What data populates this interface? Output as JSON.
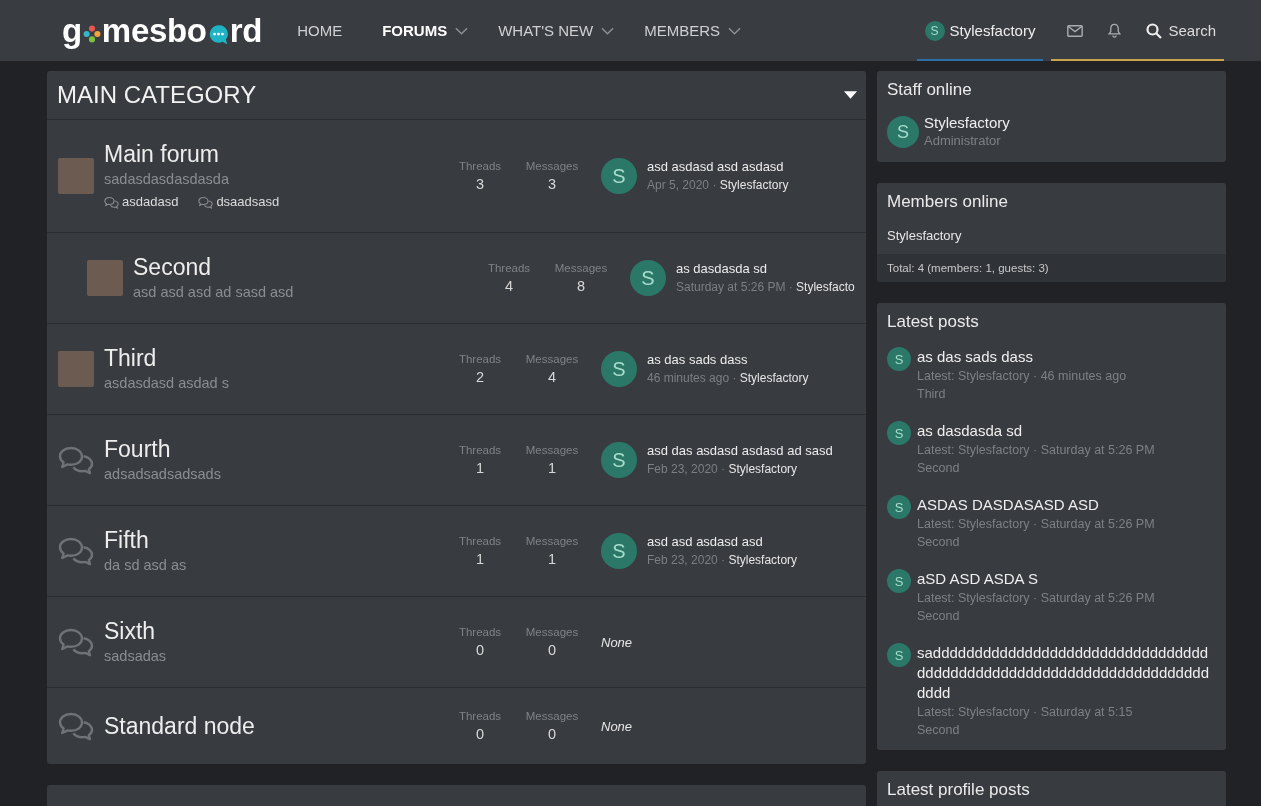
{
  "header": {
    "logo": {
      "parts": [
        "g",
        "mesbo",
        "rd"
      ]
    },
    "nav": [
      {
        "label": "HOME",
        "selected": false,
        "has_menu": false
      },
      {
        "label": "FORUMS",
        "selected": true,
        "has_menu": true
      },
      {
        "label": "WHAT'S NEW",
        "selected": false,
        "has_menu": true
      },
      {
        "label": "MEMBERS",
        "selected": false,
        "has_menu": true
      }
    ],
    "user": {
      "avatar_letter": "S",
      "name": "Stylesfactory"
    },
    "search": {
      "label": "Search"
    }
  },
  "category": {
    "title": "MAIN CATEGORY",
    "expanded": true,
    "forums": [
      {
        "kind": "photo",
        "title": "Main forum",
        "description": "sadasdasdasdasda",
        "stats": [
          {
            "label": "Threads",
            "value": "3"
          },
          {
            "label": "Messages",
            "value": "3"
          }
        ],
        "last_post": {
          "avatar_letter": "S",
          "title": "asd asdasd asd asdasd",
          "date": "Apr 5, 2020 ·",
          "author": "Stylesfactory"
        },
        "subforums": [
          "asdadasd",
          "dsaadsasd"
        ],
        "children": [
          {
            "kind": "photo",
            "title": "Second",
            "description": "asd asd asd ad sasd asd",
            "stats": [
              {
                "label": "Threads",
                "value": "4"
              },
              {
                "label": "Messages",
                "value": "8"
              }
            ],
            "last_post": {
              "avatar_letter": "S",
              "title": "as dasdasda sd",
              "date": "Saturday at 5:26 PM ·",
              "author": "Stylesfacto"
            }
          }
        ]
      },
      {
        "kind": "photo",
        "title": "Third",
        "description": "asdasdasd asdad s",
        "stats": [
          {
            "label": "Threads",
            "value": "2"
          },
          {
            "label": "Messages",
            "value": "4"
          }
        ],
        "last_post": {
          "avatar_letter": "S",
          "title": "as das sads dass",
          "date": "46 minutes ago ·",
          "author": "Stylesfactory"
        }
      },
      {
        "kind": "discussion",
        "title": "Fourth",
        "description": "adsadsadsadsads",
        "stats": [
          {
            "label": "Threads",
            "value": "1"
          },
          {
            "label": "Messages",
            "value": "1"
          }
        ],
        "last_post": {
          "avatar_letter": "S",
          "title": "asd das asdasd asdasd ad sasd",
          "date": "Feb 23, 2020 ·",
          "author": "Stylesfactory"
        }
      },
      {
        "kind": "discussion",
        "title": "Fifth",
        "description": "da sd asd as",
        "stats": [
          {
            "label": "Threads",
            "value": "1"
          },
          {
            "label": "Messages",
            "value": "1"
          }
        ],
        "last_post": {
          "avatar_letter": "S",
          "title": "asd asd asdasd asd",
          "date": "Feb 23, 2020 ·",
          "author": "Stylesfactory"
        }
      },
      {
        "kind": "discussion",
        "title": "Sixth",
        "description": "sadsadas",
        "stats": [
          {
            "label": "Threads",
            "value": "0"
          },
          {
            "label": "Messages",
            "value": "0"
          }
        ],
        "last_post_none": "None"
      },
      {
        "kind": "discussion",
        "title": "Standard node",
        "stats": [
          {
            "label": "Threads",
            "value": "0"
          },
          {
            "label": "Messages",
            "value": "0"
          }
        ],
        "last_post_none": "None"
      }
    ]
  },
  "sidebar": {
    "staff_online": {
      "title": "Staff online",
      "members": [
        {
          "avatar_letter": "S",
          "name": "Stylesfactory",
          "role": "Administrator"
        }
      ]
    },
    "members_online": {
      "title": "Members online",
      "members": [
        "Stylesfactory"
      ],
      "total": "Total: 4 (members: 1, guests: 3)"
    },
    "latest_posts": {
      "title": "Latest posts",
      "items": [
        {
          "avatar_letter": "S",
          "title": "as das sads dass",
          "meta": "Latest: Stylesfactory · 46 minutes ago",
          "forum": "Third"
        },
        {
          "avatar_letter": "S",
          "title": "as dasdasda sd",
          "meta": "Latest: Stylesfactory · Saturday at 5:26 PM",
          "forum": "Second"
        },
        {
          "avatar_letter": "S",
          "title": "ASDAS DASDASASD ASD",
          "meta": "Latest: Stylesfactory · Saturday at 5:26 PM",
          "forum": "Second"
        },
        {
          "avatar_letter": "S",
          "title": "aSD ASD ASDA S",
          "meta": "Latest: Stylesfactory · Saturday at 5:26 PM",
          "forum": "Second"
        },
        {
          "avatar_letter": "S",
          "title": "sadddddddddddddddddddddddddddddddddddddddddddddddddddddddddddddddddddddddd",
          "meta": "Latest: Stylesfactory · Saturday at 5:15",
          "forum": "Second"
        }
      ]
    },
    "latest_profile_posts": {
      "title": "Latest profile posts"
    }
  }
}
